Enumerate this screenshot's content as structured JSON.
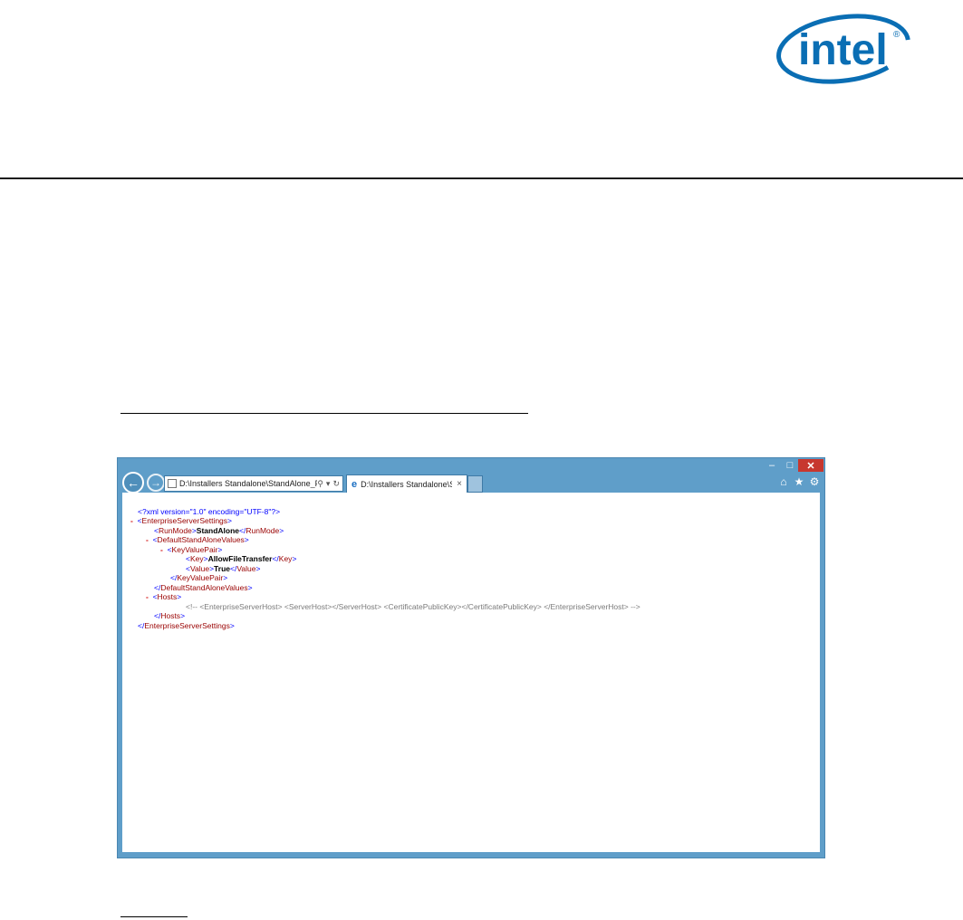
{
  "logo": {
    "text": "intel",
    "registered": "®"
  },
  "browser": {
    "address": "D:\\Installers Standalone\\StandAlone_PV\\Ho",
    "tab_title": "D:\\Installers Standalone\\Sta...",
    "tab_close": "×",
    "window_controls": {
      "minimize": "‒",
      "maximize": "□",
      "close": "✕"
    },
    "icons": {
      "back": "back-arrow-icon",
      "forward": "forward-arrow-icon",
      "search": "search-icon",
      "refresh": "refresh-icon",
      "home": "home-icon",
      "favorites": "star-icon",
      "settings": "gear-icon",
      "ie": "internet-explorer-icon"
    }
  },
  "xml": {
    "declaration": "<?xml version=\"1.0\" encoding=\"UTF-8\"?>",
    "root_open": "EnterpriseServerSettings",
    "runmode_tag": "RunMode",
    "runmode_value": "StandAlone",
    "defaults_tag": "DefaultStandAloneValues",
    "kvp_tag": "KeyValuePair",
    "key_tag": "Key",
    "key_value": "AllowFileTransfer",
    "value_tag": "Value",
    "value_value": "True",
    "hosts_tag": "Hosts",
    "comment": "<!-- <EnterpriseServerHost> <ServerHost></ServerHost> <CertificatePublicKey></CertificatePublicKey> </EnterpriseServerHost> -->",
    "collapse_marker": "-"
  }
}
